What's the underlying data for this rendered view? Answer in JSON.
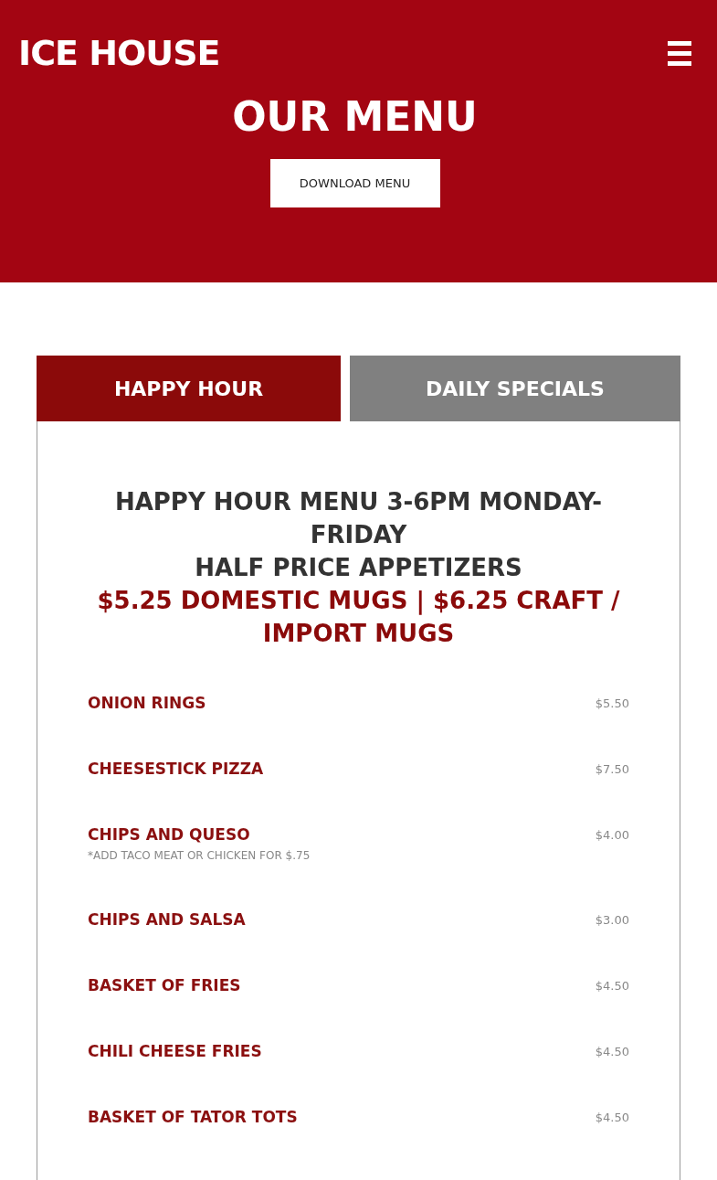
{
  "header": {
    "logo": "ICE HOUSE",
    "title": "OUR MENU",
    "button": "DOWNLOAD MENU"
  },
  "tabs": [
    {
      "label": "HAPPY HOUR",
      "selected": true
    },
    {
      "label": "DAILY SPECIALS",
      "selected": false
    }
  ],
  "intro": {
    "lines": [
      "HAPPY HOUR MENU 3-6PM MONDAY-FRIDAY",
      "HALF PRICE APPETIZERS"
    ],
    "highlight": "$5.25 DOMESTIC MUGS | $6.25 CRAFT / IMPORT MUGS"
  },
  "items": [
    {
      "name": "ONION RINGS",
      "price": "$5.50"
    },
    {
      "name": "CHEESESTICK PIZZA",
      "price": "$7.50"
    },
    {
      "name": "CHIPS AND QUESO",
      "price": "$4.00",
      "note": "*ADD TACO MEAT OR CHICKEN FOR $.75"
    },
    {
      "name": "CHIPS AND SALSA",
      "price": "$3.00"
    },
    {
      "name": "BASKET OF FRIES",
      "price": "$4.50"
    },
    {
      "name": "CHILI CHEESE FRIES",
      "price": "$4.50"
    },
    {
      "name": "BASKET OF TATOR TOTS",
      "price": "$4.50"
    }
  ]
}
